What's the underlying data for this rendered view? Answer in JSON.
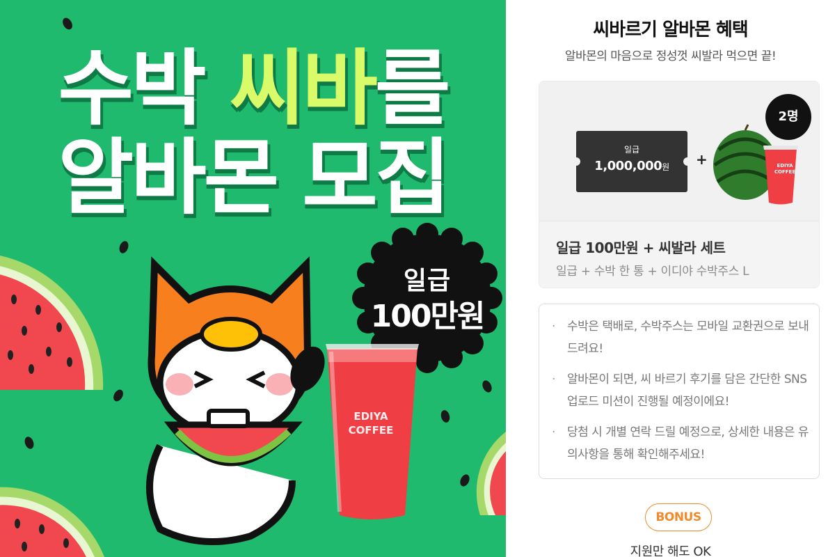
{
  "banner": {
    "headline_line1_part1": "수박 ",
    "headline_line1_accent": "씨바",
    "headline_line1_part2": "를",
    "headline_line2": "알바몬 모집",
    "badge_line1": "일급",
    "badge_line2": "100만원",
    "cup_brand_line1": "EDIYA",
    "cup_brand_line2": "COFFEE",
    "colors": {
      "background": "#1fba6e",
      "accent": "#d9fb6a",
      "badge": "#111111"
    }
  },
  "panel": {
    "title": "씨바르기 알바몬 혜택",
    "subtitle": "알바몬의 마음으로 정성껏 씨발라 먹으면 끝!",
    "prize": {
      "winner_count": "2명",
      "ticket_label": "일급",
      "ticket_amount": "1,000,000",
      "ticket_unit": "원",
      "plus": "+",
      "name": "일급 100만원 + 씨발라 세트",
      "detail": "일급 + 수박 한 통 + 이디야 수박주스 L",
      "cup_brand_line1": "EDIYA",
      "cup_brand_line2": "COFFEE"
    },
    "notices": [
      {
        "bullet": "·",
        "text": "수박은 택배로, 수박주스는 모바일 교환권으로 보내드려요!"
      },
      {
        "bullet": "·",
        "text": "알바몬이 되면, 씨 바르기 후기를 담은 간단한 SNS 업로드 미션이 진행될 예정이에요!"
      },
      {
        "bullet": "·",
        "text": "당첨 시 개별 연락 드릴 예정으로, 상세한 내용은 유의사항을 통해 확인해주세요!"
      }
    ],
    "bonus_label": "BONUS",
    "bonus_caption": "지원만 해도 OK",
    "colors": {
      "bonus": "#f08a2a",
      "ticket": "#333333"
    }
  }
}
